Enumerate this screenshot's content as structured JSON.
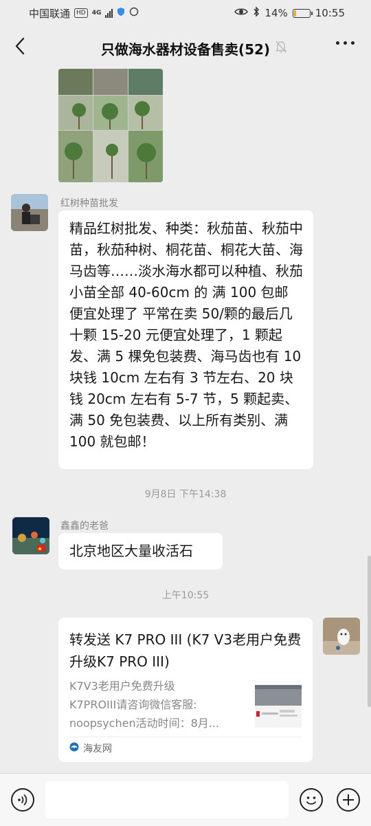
{
  "status_bar": {
    "carrier": "中国联通",
    "hd": "HD",
    "net": "4G",
    "battery_pct": "14%",
    "battery_level": 0.14,
    "time": "10:55",
    "icons": [
      "shield-icon",
      "circle-icon",
      "eye-icon",
      "bluetooth-icon"
    ]
  },
  "nav": {
    "title": "只做海水器材设备售卖(52)",
    "icons": [
      "back-arrow-icon",
      "mute-bell-icon",
      "more-dots-icon"
    ]
  },
  "messages": [
    {
      "sender": "红树种苗批发",
      "text": "精品红树批发、种类：秋茄苗、秋茄中苗，秋茄种树、桐花苗、桐花大苗、海马齿等……淡水海水都可以种植、秋茄小苗全部 40-60cm 的 满 100 包邮 便宜处理了 平常在卖 50/颗的最后几十颗 15-20 元便宜处理了，1 颗起发、满 5 棵免包装费、海马齿也有 10 块钱 10cm 左右有 3 节左右、20 块钱 20cm 左右有 5-7 节，5 颗起卖、满 50 免包装费、以上所有类别、满 100 就包邮！"
    },
    {
      "sender": "鑫鑫的老爸",
      "text": "北京地区大量收活石"
    }
  ],
  "timestamps": [
    "9月8日 下午14:38",
    "上午10:55"
  ],
  "link_card": {
    "title": "转发送 K7 PRO III (K7 V3老用户免费升级K7 PRO III)",
    "desc_lines": [
      "K7V3老用户免费升级",
      "K7PROIII请咨询微信客服:",
      "noopsychen活动时间：8月..."
    ],
    "source": "海友网"
  },
  "input_bar": {
    "icons": [
      "voice-icon",
      "emoji-icon",
      "plus-icon"
    ]
  }
}
